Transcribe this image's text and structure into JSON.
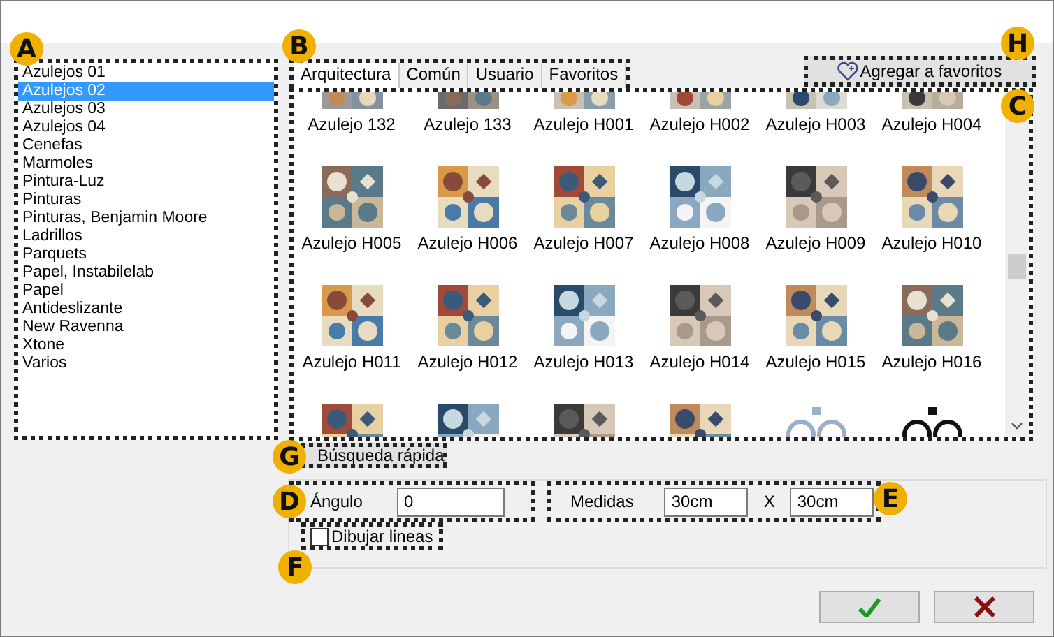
{
  "categories": [
    {
      "label": "Azulejos 01",
      "selected": false
    },
    {
      "label": "Azulejos 02",
      "selected": true
    },
    {
      "label": "Azulejos 03",
      "selected": false
    },
    {
      "label": "Azulejos 04",
      "selected": false
    },
    {
      "label": "Cenefas",
      "selected": false
    },
    {
      "label": "Marmoles",
      "selected": false
    },
    {
      "label": "Pintura-Luz",
      "selected": false
    },
    {
      "label": "Pinturas",
      "selected": false
    },
    {
      "label": "Pinturas, Benjamin Moore",
      "selected": false
    },
    {
      "label": "Ladrillos",
      "selected": false
    },
    {
      "label": "Parquets",
      "selected": false
    },
    {
      "label": "Papel, Instabilelab",
      "selected": false
    },
    {
      "label": "Papel",
      "selected": false
    },
    {
      "label": "Antideslizante",
      "selected": false
    },
    {
      "label": "New Ravenna",
      "selected": false
    },
    {
      "label": "Xtone",
      "selected": false
    },
    {
      "label": "Varios",
      "selected": false
    }
  ],
  "tabs": [
    {
      "label": "Arquitectura",
      "selected": true
    },
    {
      "label": "Común",
      "selected": false
    },
    {
      "label": "Usuario",
      "selected": false
    },
    {
      "label": "Favoritos",
      "selected": false
    }
  ],
  "favorite_button": "Agregar a favoritos",
  "tiles": [
    {
      "label": "Azulejo 132"
    },
    {
      "label": "Azulejo 133"
    },
    {
      "label": "Azulejo H001"
    },
    {
      "label": "Azulejo H002"
    },
    {
      "label": "Azulejo H003"
    },
    {
      "label": "Azulejo H004"
    },
    {
      "label": "Azulejo H005"
    },
    {
      "label": "Azulejo H006"
    },
    {
      "label": "Azulejo H007"
    },
    {
      "label": "Azulejo H008"
    },
    {
      "label": "Azulejo H009"
    },
    {
      "label": "Azulejo H010"
    },
    {
      "label": "Azulejo H011"
    },
    {
      "label": "Azulejo H012"
    },
    {
      "label": "Azulejo H013"
    },
    {
      "label": "Azulejo H014"
    },
    {
      "label": "Azulejo H015"
    },
    {
      "label": "Azulejo H016"
    },
    {
      "kind": "picture"
    },
    {
      "kind": "picture"
    },
    {
      "kind": "picture"
    },
    {
      "kind": "picture"
    },
    {
      "kind": "picture"
    },
    {
      "kind": "picture"
    }
  ],
  "quick_search_tab": "Búsqueda rápida",
  "angle": {
    "label": "Ángulo",
    "value": "0"
  },
  "size": {
    "label": "Medidas",
    "width": "30cm",
    "separator": "X",
    "height": "30cm"
  },
  "draw_lines": {
    "label": "Dibujar lineas",
    "checked": false
  },
  "callouts": [
    "A",
    "B",
    "H",
    "C",
    "G",
    "D",
    "E",
    "F"
  ]
}
